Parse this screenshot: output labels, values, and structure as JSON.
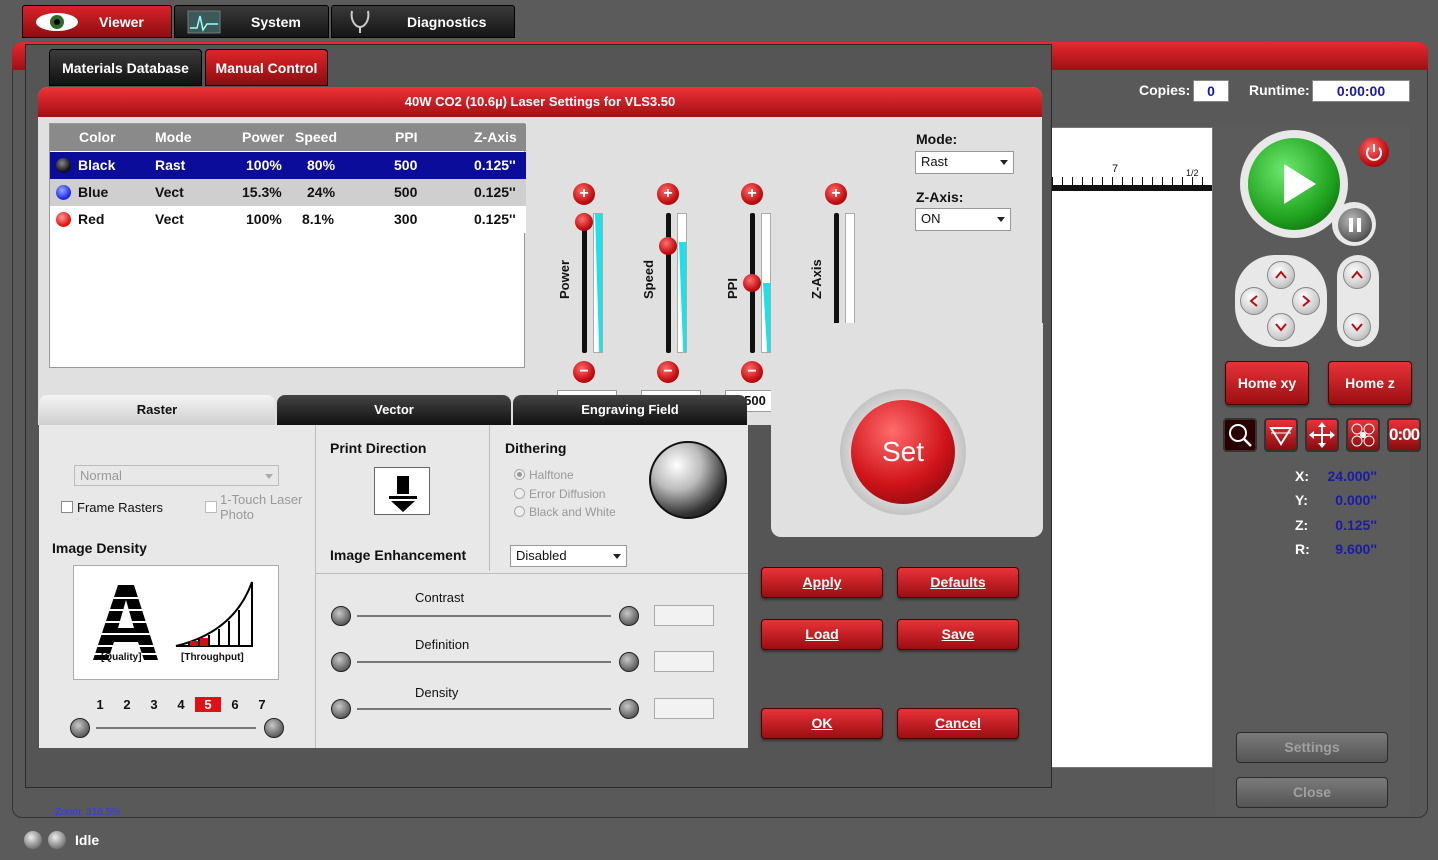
{
  "top_tabs": [
    {
      "label": "Viewer"
    },
    {
      "label": "System"
    },
    {
      "label": "Diagnostics"
    }
  ],
  "copies": {
    "label": "Copies:",
    "value": "0"
  },
  "runtime": {
    "label": "Runtime:",
    "value": "0:00:00"
  },
  "ruler": {
    "tick_label": "7",
    "half_label": "1/2"
  },
  "dialog": {
    "tabs": [
      {
        "label": "Materials Database"
      },
      {
        "label": "Manual Control"
      }
    ],
    "title": "40W CO2 (10.6µ) Laser Settings for VLS3.50",
    "table": {
      "headers": [
        "Color",
        "Mode",
        "Power",
        "Speed",
        "PPI",
        "Z-Axis"
      ],
      "rows": [
        {
          "color": "Black",
          "mode": "Rast",
          "power": "100%",
          "speed": "80%",
          "ppi": "500",
          "z": "0.125''"
        },
        {
          "color": "Blue",
          "mode": "Vect",
          "power": "15.3%",
          "speed": "24%",
          "ppi": "500",
          "z": "0.125''"
        },
        {
          "color": "Red",
          "mode": "Vect",
          "power": "100%",
          "speed": "8.1%",
          "ppi": "300",
          "z": "0.125''"
        }
      ]
    },
    "sliders": [
      {
        "label": "Power",
        "value": "100%",
        "fraction": 1.0
      },
      {
        "label": "Speed",
        "value": "80%",
        "fraction": 0.8
      },
      {
        "label": "PPI",
        "value": "500",
        "fraction": 0.5
      },
      {
        "label": "Z-Axis",
        "value": "0.125''",
        "fraction": 0.0
      }
    ],
    "plus": "+",
    "minus": "−",
    "mode": {
      "label": "Mode:",
      "value": "Rast"
    },
    "zaxis": {
      "label": "Z-Axis:",
      "value": "ON"
    },
    "set_label": "Set",
    "lower_tabs": [
      {
        "label": "Raster"
      },
      {
        "label": "Vector"
      },
      {
        "label": "Engraving Field"
      }
    ],
    "raster": {
      "mode_value": "Normal",
      "frame_rasters": "Frame Rasters",
      "one_touch": "1-Touch Laser Photo",
      "image_density": "Image Density",
      "quality": "[Quality]",
      "throughput": "[Throughput]",
      "density_levels": [
        "1",
        "2",
        "3",
        "4",
        "5",
        "6",
        "7"
      ],
      "density_selected": "5",
      "print_direction": "Print Direction",
      "dithering": "Dithering",
      "dither_options": [
        "Halftone",
        "Error Diffusion",
        "Black and White"
      ],
      "image_enhancement": "Image Enhancement",
      "enhancement_value": "Disabled",
      "contrast": "Contrast",
      "definition": "Definition",
      "density": "Density"
    },
    "buttons": {
      "apply": "Apply",
      "defaults": "Defaults",
      "load": "Load",
      "save": "Save",
      "ok": "OK",
      "cancel": "Cancel"
    }
  },
  "right_panel": {
    "home_xy": "Home xy",
    "home_z": "Home z",
    "timer_icon_text": "0:00",
    "coords": [
      {
        "label": "X:",
        "value": "24.000''"
      },
      {
        "label": "Y:",
        "value": "0.000''"
      },
      {
        "label": "Z:",
        "value": "0.125''"
      },
      {
        "label": "R:",
        "value": "9.600''"
      }
    ],
    "settings": "Settings",
    "close": "Close"
  },
  "zoom": "Zoom:  316.5%",
  "status": "Idle",
  "colors": {
    "accent_red": "#c8161b",
    "selection_blue": "#0c0c9a",
    "value_blue": "#1c1ca0"
  }
}
